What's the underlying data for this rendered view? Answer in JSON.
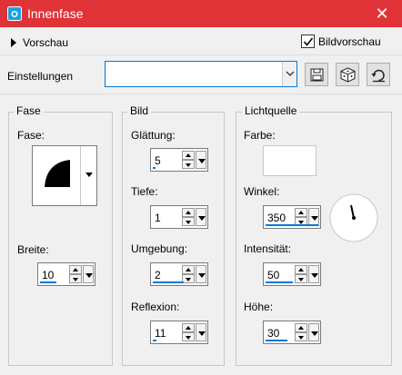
{
  "window": {
    "title": "Innenfase",
    "close_glyph": "✕"
  },
  "top": {
    "preview_label": "Vorschau",
    "bildvorschau_label": "Bildvorschau",
    "bildvorschau_checked": true,
    "einstellungen_label": "Einstellungen",
    "einstellungen_value": ""
  },
  "icons": [
    "camera-icon",
    "close-icon",
    "play-triangle-icon",
    "checkmark-icon",
    "chevron-down-icon",
    "save-icon",
    "dice-icon",
    "reset-icon",
    "spin-up-icon",
    "spin-down-icon",
    "dropdown-arrow-icon",
    "quarter-circle-icon",
    "dial-icon"
  ],
  "fase": {
    "group_title": "Fase",
    "fase_label": "Fase:",
    "breite_label": "Breite:",
    "breite_value": "10"
  },
  "bild": {
    "group_title": "Bild",
    "glaettung_label": "Glättung:",
    "glaettung_value": "5",
    "tiefe_label": "Tiefe:",
    "tiefe_value": "1",
    "umgebung_label": "Umgebung:",
    "umgebung_value": "2",
    "reflexion_label": "Reflexion:",
    "reflexion_value": "11"
  },
  "licht": {
    "group_title": "Lichtquelle",
    "farbe_label": "Farbe:",
    "farbe_color": "#ffffff",
    "winkel_label": "Winkel:",
    "winkel_value": "350",
    "intensitaet_label": "Intensität:",
    "intensitaet_value": "50",
    "hoehe_label": "Höhe:",
    "hoehe_value": "30"
  },
  "colors": {
    "titlebar": "#e03338",
    "accent": "#0078d7"
  }
}
